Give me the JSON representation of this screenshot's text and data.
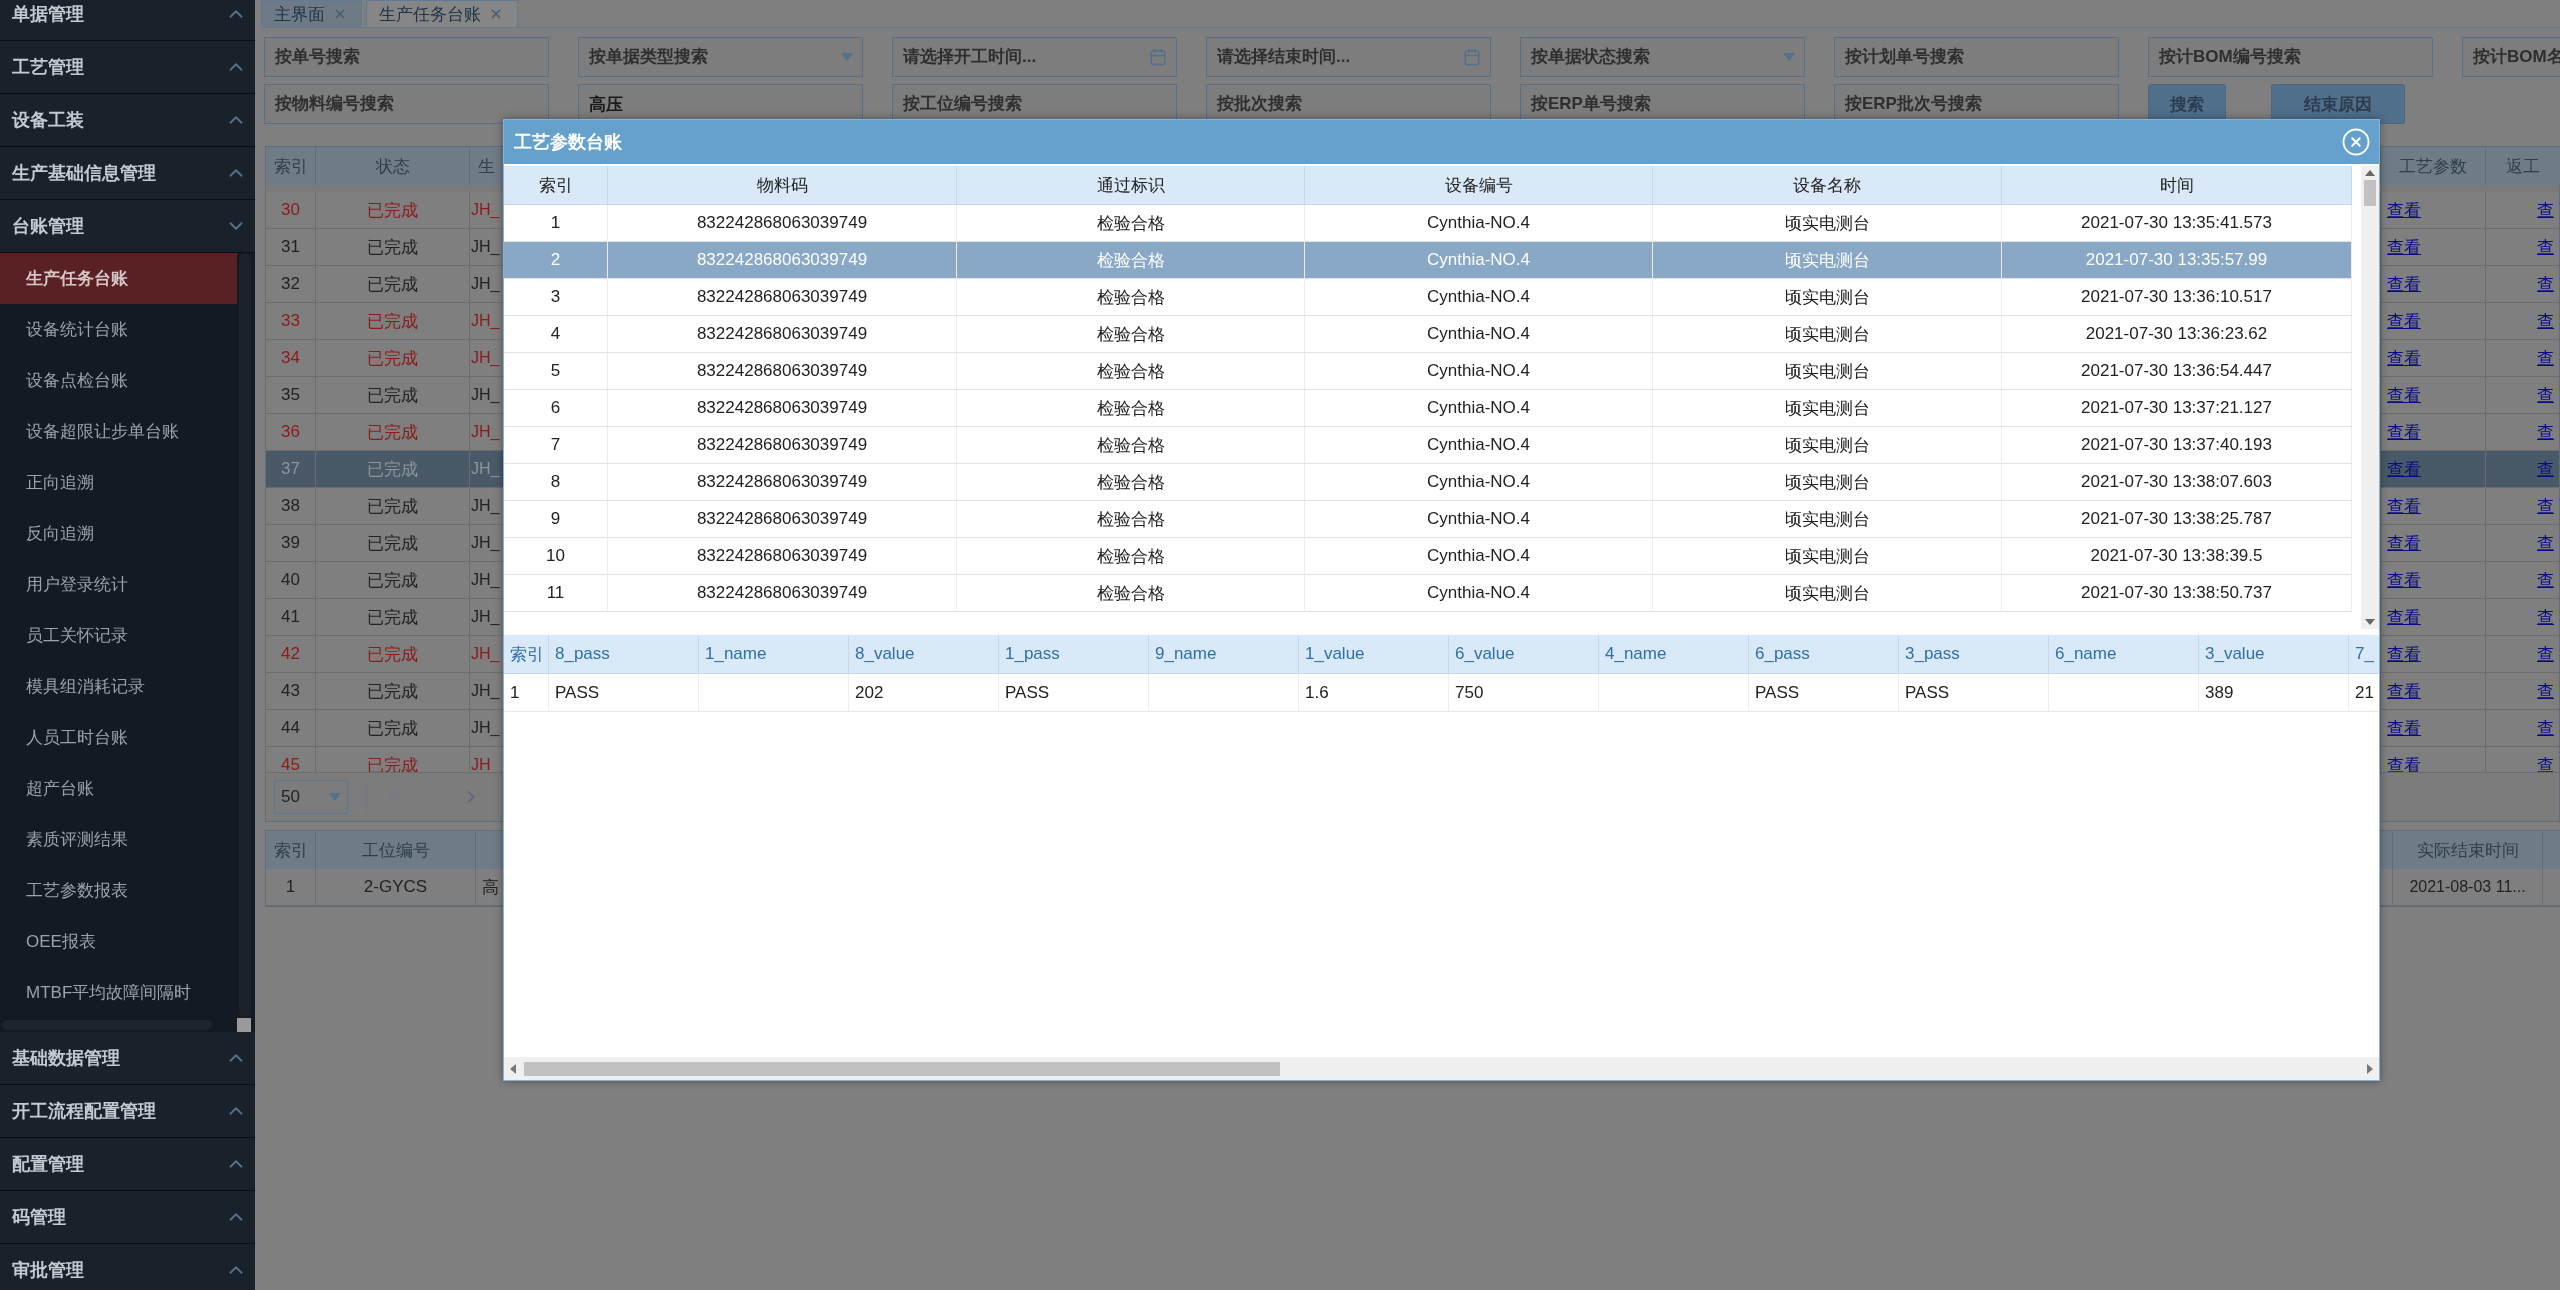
{
  "sidebar": {
    "groups": [
      {
        "label": "单据管理",
        "expanded": false
      },
      {
        "label": "工艺管理",
        "expanded": false
      },
      {
        "label": "设备工装",
        "expanded": false
      },
      {
        "label": "生产基础信息管理",
        "expanded": false
      },
      {
        "label": "台账管理",
        "expanded": true,
        "children": [
          {
            "label": "生产任务台账",
            "selected": true
          },
          {
            "label": "设备统计台账",
            "selected": false
          },
          {
            "label": "设备点检台账",
            "selected": false
          },
          {
            "label": "设备超限让步单台账",
            "selected": false
          },
          {
            "label": "正向追溯",
            "selected": false
          },
          {
            "label": "反向追溯",
            "selected": false
          },
          {
            "label": "用户登录统计",
            "selected": false
          },
          {
            "label": "员工关怀记录",
            "selected": false
          },
          {
            "label": "模具组消耗记录",
            "selected": false
          },
          {
            "label": "人员工时台账",
            "selected": false
          },
          {
            "label": "超产台账",
            "selected": false
          },
          {
            "label": "素质评测结果",
            "selected": false
          },
          {
            "label": "工艺参数报表",
            "selected": false
          },
          {
            "label": "OEE报表",
            "selected": false
          },
          {
            "label": "MTBF平均故障间隔时",
            "selected": false
          }
        ]
      },
      {
        "label": "基础数据管理",
        "expanded": false
      },
      {
        "label": "开工流程配置管理",
        "expanded": false
      },
      {
        "label": "配置管理",
        "expanded": false
      },
      {
        "label": "码管理",
        "expanded": false
      },
      {
        "label": "审批管理",
        "expanded": false
      }
    ]
  },
  "tabs": [
    {
      "label": "主界面",
      "selected": false
    },
    {
      "label": "生产任务台账",
      "selected": true
    }
  ],
  "filters": [
    {
      "kind": "text",
      "placeholder": "按单号搜索"
    },
    {
      "kind": "select",
      "placeholder": "按单据类型搜索"
    },
    {
      "kind": "date",
      "placeholder": "请选择开工时间..."
    },
    {
      "kind": "date",
      "placeholder": "请选择结束时间..."
    },
    {
      "kind": "select",
      "placeholder": "按单据状态搜索"
    },
    {
      "kind": "text",
      "placeholder": "按计划单号搜索"
    },
    {
      "kind": "text",
      "placeholder": "按计BOM编号搜索"
    },
    {
      "kind": "text",
      "placeholder": "按计BOM名"
    },
    {
      "kind": "text",
      "placeholder": "按物料编号搜索"
    },
    {
      "kind": "text",
      "value": "高压"
    },
    {
      "kind": "text",
      "placeholder": "按工位编号搜索"
    },
    {
      "kind": "text",
      "placeholder": "按批次搜索"
    },
    {
      "kind": "text",
      "placeholder": "按ERP单号搜索"
    },
    {
      "kind": "text",
      "placeholder": "按ERP批次号搜索"
    }
  ],
  "buttons": [
    "搜索",
    "结束原因"
  ],
  "task_table": {
    "columns": [
      "索引",
      "状态",
      "生",
      "工艺参数",
      "返工"
    ],
    "rows": [
      {
        "index": "30",
        "status": "已完成",
        "code": "JH_",
        "params": "查看",
        "rework": "查",
        "kind": "warning",
        "selected": false
      },
      {
        "index": "31",
        "status": "已完成",
        "code": "JH_",
        "params": "查看",
        "rework": "查",
        "kind": "normal",
        "selected": false
      },
      {
        "index": "32",
        "status": "已完成",
        "code": "JH_",
        "params": "查看",
        "rework": "查",
        "kind": "normal",
        "selected": false
      },
      {
        "index": "33",
        "status": "已完成",
        "code": "JH_",
        "params": "查看",
        "rework": "查",
        "kind": "warning",
        "selected": false
      },
      {
        "index": "34",
        "status": "已完成",
        "code": "JH_",
        "params": "查看",
        "rework": "查",
        "kind": "warning",
        "selected": false
      },
      {
        "index": "35",
        "status": "已完成",
        "code": "JH_",
        "params": "查看",
        "rework": "查",
        "kind": "normal",
        "selected": false
      },
      {
        "index": "36",
        "status": "已完成",
        "code": "JH_",
        "params": "查看",
        "rework": "查",
        "kind": "warning",
        "selected": false
      },
      {
        "index": "37",
        "status": "已完成",
        "code": "JH_",
        "params": "查看",
        "rework": "查",
        "selected": true
      },
      {
        "index": "38",
        "status": "已完成",
        "code": "JH_",
        "params": "查看",
        "rework": "查",
        "kind": "normal",
        "selected": false
      },
      {
        "index": "39",
        "status": "已完成",
        "code": "JH_",
        "params": "查看",
        "rework": "查",
        "kind": "normal",
        "selected": false
      },
      {
        "index": "40",
        "status": "已完成",
        "code": "JH_",
        "params": "查看",
        "rework": "查",
        "kind": "normal",
        "selected": false
      },
      {
        "index": "41",
        "status": "已完成",
        "code": "JH_",
        "params": "查看",
        "rework": "查",
        "kind": "normal",
        "selected": false
      },
      {
        "index": "42",
        "status": "已完成",
        "code": "JH_",
        "params": "查看",
        "rework": "查",
        "kind": "warning",
        "selected": false
      },
      {
        "index": "43",
        "status": "已完成",
        "code": "JH_",
        "params": "查看",
        "rework": "查",
        "kind": "normal",
        "selected": false
      },
      {
        "index": "44",
        "status": "已完成",
        "code": "JH_",
        "params": "查看",
        "rework": "查",
        "kind": "normal",
        "selected": false
      },
      {
        "index": "45",
        "status": "已完成",
        "code": "JH",
        "params": "查看",
        "rework": "查",
        "kind": "warning",
        "selected": false
      }
    ]
  },
  "pagination": {
    "page_size": "50"
  },
  "station_table": {
    "columns": [
      "索引",
      "工位编号",
      "实际结束时间"
    ],
    "rows": [
      {
        "index": "1",
        "station": "2-GYCS",
        "column_3": "高",
        "end_time": "2021-08-03 11..."
      }
    ]
  },
  "modal": {
    "title": "工艺参数台账",
    "records": {
      "columns": [
        "索引",
        "物料码",
        "通过标识",
        "设备编号",
        "设备名称",
        "时间"
      ],
      "rows": [
        {
          "cells": [
            "1",
            "832242868063039749",
            "检验合格",
            "Cynthia-NO.4",
            "顷实电测台",
            "2021-07-30 13:35:41.573"
          ],
          "selected": false
        },
        {
          "cells": [
            "2",
            "832242868063039749",
            "检验合格",
            "Cynthia-NO.4",
            "顷实电测台",
            "2021-07-30 13:35:57.99"
          ],
          "selected": true
        },
        {
          "cells": [
            "3",
            "832242868063039749",
            "检验合格",
            "Cynthia-NO.4",
            "顷实电测台",
            "2021-07-30 13:36:10.517"
          ],
          "selected": false
        },
        {
          "cells": [
            "4",
            "832242868063039749",
            "检验合格",
            "Cynthia-NO.4",
            "顷实电测台",
            "2021-07-30 13:36:23.62"
          ],
          "selected": false
        },
        {
          "cells": [
            "5",
            "832242868063039749",
            "检验合格",
            "Cynthia-NO.4",
            "顷实电测台",
            "2021-07-30 13:36:54.447"
          ],
          "selected": false
        },
        {
          "cells": [
            "6",
            "832242868063039749",
            "检验合格",
            "Cynthia-NO.4",
            "顷实电测台",
            "2021-07-30 13:37:21.127"
          ],
          "selected": false
        },
        {
          "cells": [
            "7",
            "832242868063039749",
            "检验合格",
            "Cynthia-NO.4",
            "顷实电测台",
            "2021-07-30 13:37:40.193"
          ],
          "selected": false
        },
        {
          "cells": [
            "8",
            "832242868063039749",
            "检验合格",
            "Cynthia-NO.4",
            "顷实电测台",
            "2021-07-30 13:38:07.603"
          ],
          "selected": false
        },
        {
          "cells": [
            "9",
            "832242868063039749",
            "检验合格",
            "Cynthia-NO.4",
            "顷实电测台",
            "2021-07-30 13:38:25.787"
          ],
          "selected": false
        },
        {
          "cells": [
            "10",
            "832242868063039749",
            "检验合格",
            "Cynthia-NO.4",
            "顷实电测台",
            "2021-07-30 13:38:39.5"
          ],
          "selected": false
        },
        {
          "cells": [
            "11",
            "832242868063039749",
            "检验合格",
            "Cynthia-NO.4",
            "顷实电测台",
            "2021-07-30 13:38:50.737"
          ],
          "selected": false
        }
      ]
    },
    "params": {
      "columns": [
        "索引",
        "8_pass",
        "1_name",
        "8_value",
        "1_pass",
        "9_name",
        "1_value",
        "6_value",
        "4_name",
        "6_pass",
        "3_pass",
        "6_name",
        "3_value",
        "7_"
      ],
      "rows": [
        [
          "1",
          "PASS",
          null,
          "202",
          "PASS",
          null,
          "1.6",
          "750",
          null,
          "PASS",
          "PASS",
          null,
          "389",
          "21"
        ]
      ]
    }
  }
}
